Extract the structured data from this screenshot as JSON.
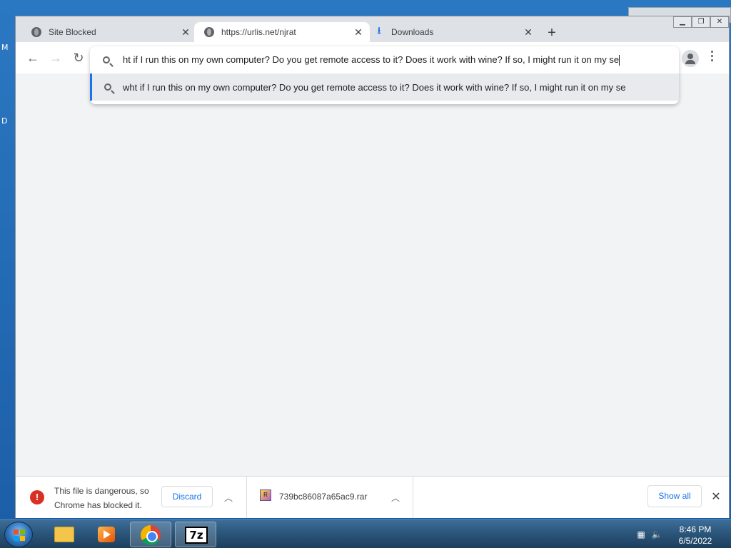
{
  "desktop": {
    "letters": [
      "M",
      "D"
    ]
  },
  "tabs": [
    {
      "title": "Site Blocked",
      "icon": "globe-icon"
    },
    {
      "title": "https://urlis.net/njrat",
      "icon": "globe-icon"
    },
    {
      "title": "Downloads",
      "icon": "download-icon"
    }
  ],
  "window_controls": {
    "minimize": "▁",
    "restore": "❐",
    "close": "✕"
  },
  "omnibox": {
    "input_text": "ht if I run this on my own computer? Do you get remote access to it? Does it work with wine? If so, I might run it on my se",
    "suggestion_text": "wht if I run this on my own computer? Do you get remote access to it? Does it work with wine? If so, I might run it on my se"
  },
  "download_shelf": {
    "warning_text": "This file is dangerous, so Chrome has blocked it.",
    "discard_label": "Discard",
    "file_name": "739bc86087a65ac9.rar",
    "show_all_label": "Show all"
  },
  "taskbar": {
    "clock_time": "8:46 PM",
    "clock_date": "6/5/2022",
    "apps": [
      "explorer",
      "media-player",
      "chrome",
      "7-zip"
    ],
    "sevenzip_label": "7z"
  },
  "colors": {
    "accent": "#1a73e8",
    "danger": "#d93025",
    "taskbar": "#2a5478"
  }
}
